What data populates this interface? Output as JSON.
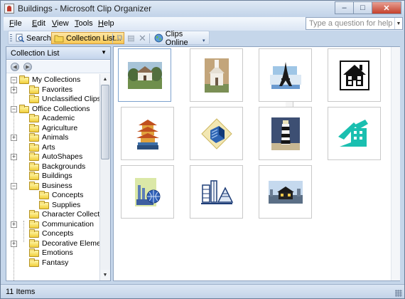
{
  "window": {
    "title": "Buildings - Microsoft Clip Organizer",
    "controls": {
      "minimize": "–",
      "maximize": "□",
      "close": "✕"
    }
  },
  "menubar": {
    "items": [
      {
        "label": "File",
        "accel": "F",
        "rest": "ile"
      },
      {
        "label": "Edit",
        "accel": "E",
        "rest": "dit"
      },
      {
        "label": "View",
        "accel": "V",
        "rest": "iew"
      },
      {
        "label": "Tools",
        "accel": "T",
        "rest": "ools"
      },
      {
        "label": "Help",
        "accel": "H",
        "rest": "elp"
      }
    ],
    "help_placeholder": "Type a question for help"
  },
  "toolbar": {
    "search_label": "Search...",
    "collection_list_label": "Collection List...",
    "clips_online_label": "Clips Online"
  },
  "collection_pane": {
    "header": "Collection List",
    "tree": [
      {
        "label": "My Collections",
        "expander": "−"
      },
      {
        "label": "Favorites",
        "expander": "+"
      },
      {
        "label": "Unclassified Clips",
        "expander": ""
      },
      {
        "label": "Office Collections",
        "expander": "−"
      },
      {
        "label": "Academic",
        "expander": ""
      },
      {
        "label": "Agriculture",
        "expander": ""
      },
      {
        "label": "Animals",
        "expander": "+"
      },
      {
        "label": "Arts",
        "expander": ""
      },
      {
        "label": "AutoShapes",
        "expander": "+"
      },
      {
        "label": "Backgrounds",
        "expander": ""
      },
      {
        "label": "Buildings",
        "expander": ""
      },
      {
        "label": "Business",
        "expander": "−"
      },
      {
        "label": "Concepts",
        "expander": ""
      },
      {
        "label": "Supplies",
        "expander": ""
      },
      {
        "label": "Character Collection",
        "expander": ""
      },
      {
        "label": "Communication",
        "expander": "+"
      },
      {
        "label": "Concepts",
        "expander": ""
      },
      {
        "label": "Decorative Elements",
        "expander": "+"
      },
      {
        "label": "Emotions",
        "expander": ""
      },
      {
        "label": "Fantasy",
        "expander": ""
      }
    ]
  },
  "clips": [
    {
      "name": "country-house-clip"
    },
    {
      "name": "white-church-clip"
    },
    {
      "name": "eiffel-tower-clip"
    },
    {
      "name": "house-silhouette-clip"
    },
    {
      "name": "pagoda-clip"
    },
    {
      "name": "office-building-clip"
    },
    {
      "name": "lighthouse-clip"
    },
    {
      "name": "teal-building-clip"
    },
    {
      "name": "factory-globe-clip"
    },
    {
      "name": "city-skyline-clip"
    },
    {
      "name": "night-house-clip"
    }
  ],
  "status": {
    "text": "11 Items"
  },
  "colors": {
    "accent": "#f8c957",
    "chrome": "#c5d6ea",
    "selection": "#7da2ce"
  }
}
